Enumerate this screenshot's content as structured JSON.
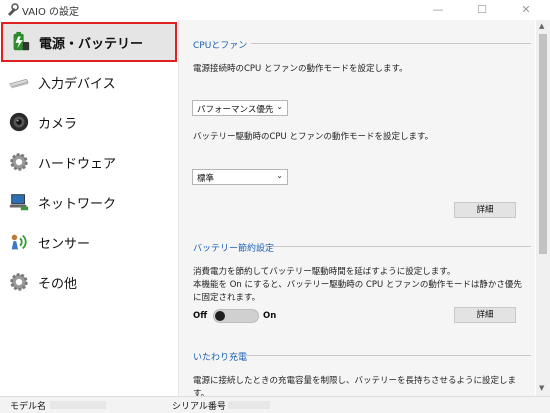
{
  "window": {
    "title": "VAIO の設定",
    "min_glyph": "—",
    "max_glyph": "☐",
    "close_glyph": "✕"
  },
  "sidebar": {
    "items": [
      {
        "label": "電源・バッテリー",
        "icon": "battery-icon",
        "active": true
      },
      {
        "label": "入力デバイス",
        "icon": "input-device-icon",
        "active": false
      },
      {
        "label": "カメラ",
        "icon": "camera-icon",
        "active": false
      },
      {
        "label": "ハードウェア",
        "icon": "hardware-gear-icon",
        "active": false
      },
      {
        "label": "ネットワーク",
        "icon": "network-icon",
        "active": false
      },
      {
        "label": "センサー",
        "icon": "sensor-icon",
        "active": false
      },
      {
        "label": "その他",
        "icon": "other-gear-icon",
        "active": false
      }
    ],
    "active_border_color": "#e02020"
  },
  "main": {
    "cpu_fan": {
      "heading": "CPUとファン",
      "ac_desc": "電源接続時のCPU とファンの動作モードを設定します。",
      "ac_mode": "パフォーマンス優先",
      "battery_desc": "バッテリー駆動時のCPU とファンの動作モードを設定します。",
      "battery_mode": "標準",
      "details_label": "詳細"
    },
    "battery_saving": {
      "heading": "バッテリー節約設定",
      "desc_line1": "消費電力を節約してバッテリー駆動時間を延ばすように設定します。",
      "desc_line2": "本機能を On にすると、バッテリー駆動時の CPU とファンの動作モードは静かさ優先",
      "desc_line3": "に固定されます。",
      "toggle_off_label": "Off",
      "toggle_on_label": "On",
      "toggle_state": "Off",
      "details_label": "詳細"
    },
    "care_charge": {
      "heading": "いたわり充電",
      "desc": "電源に接続したときの充電容量を制限し、バッテリーを長持ちさせるように設定しま",
      "desc_cont": "す。"
    }
  },
  "scrollbar": {
    "up_glyph": "▲",
    "down_glyph": "▼"
  },
  "statusbar": {
    "model_label": "モデル名",
    "serial_label": "シリアル番号"
  },
  "colors": {
    "heading_blue": "#1a5fb4",
    "sidebar_bg": "#ffffff",
    "content_bg": "#f5f5f5"
  }
}
